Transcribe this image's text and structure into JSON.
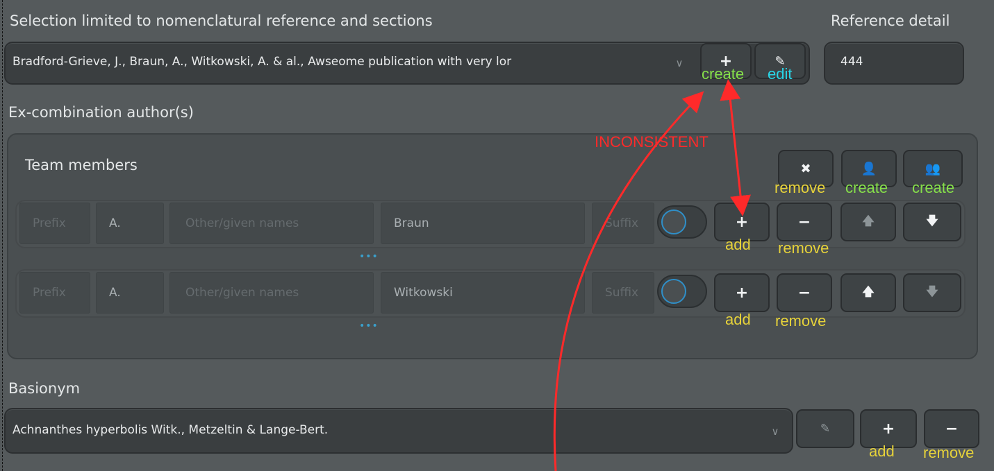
{
  "reference": {
    "selection_label": "Selection limited to nomenclatural reference and sections",
    "detail_label": "Reference detail",
    "combo_value": "Bradford-Grieve, J., Braun, A., Witkowski, A. & al., Awseome publication with very lor",
    "detail_value": "444",
    "create_btn_glyph": "+",
    "edit_btn_glyph": "✎"
  },
  "excombination": {
    "label": "Ex-combination author(s)",
    "team_title": "Team members",
    "remove_glyph": "✖",
    "create_person_glyph": "👤",
    "create_team_glyph": "👥",
    "members": [
      {
        "prefix_placeholder": "Prefix",
        "initials": "A.",
        "given_placeholder": "Other/given names",
        "family": "Braun",
        "suffix_placeholder": "Suffix",
        "add_glyph": "+",
        "remove_glyph": "−",
        "up_glyph": "🡅",
        "down_glyph": "🡇",
        "dots": "•••"
      },
      {
        "prefix_placeholder": "Prefix",
        "initials": "A.",
        "given_placeholder": "Other/given names",
        "family": "Witkowski",
        "suffix_placeholder": "Suffix",
        "add_glyph": "+",
        "remove_glyph": "−",
        "up_glyph": "🡅",
        "down_glyph": "🡇",
        "dots": "•••"
      }
    ]
  },
  "basionym": {
    "label": "Basionym",
    "combo_value": "Achnanthes hyperbolis Witk., Metzeltin & Lange-Bert.",
    "edit_glyph": "✎",
    "add_glyph": "+",
    "remove_glyph": "−"
  },
  "annotations": {
    "ref_create": "create",
    "ref_edit": "edit",
    "inconsistent": "INCONSISTENT",
    "team_remove": "remove",
    "team_create_person": "create",
    "team_create_team": "create",
    "row1_add": "add",
    "row1_remove": "remove",
    "row2_add": "add",
    "row2_remove": "remove",
    "bas_add": "add",
    "bas_remove": "remove",
    "colors": {
      "green": "#86e04a",
      "yellow": "#e6d23a",
      "cyan": "#29d7e8",
      "red": "#ff2a2a"
    }
  }
}
